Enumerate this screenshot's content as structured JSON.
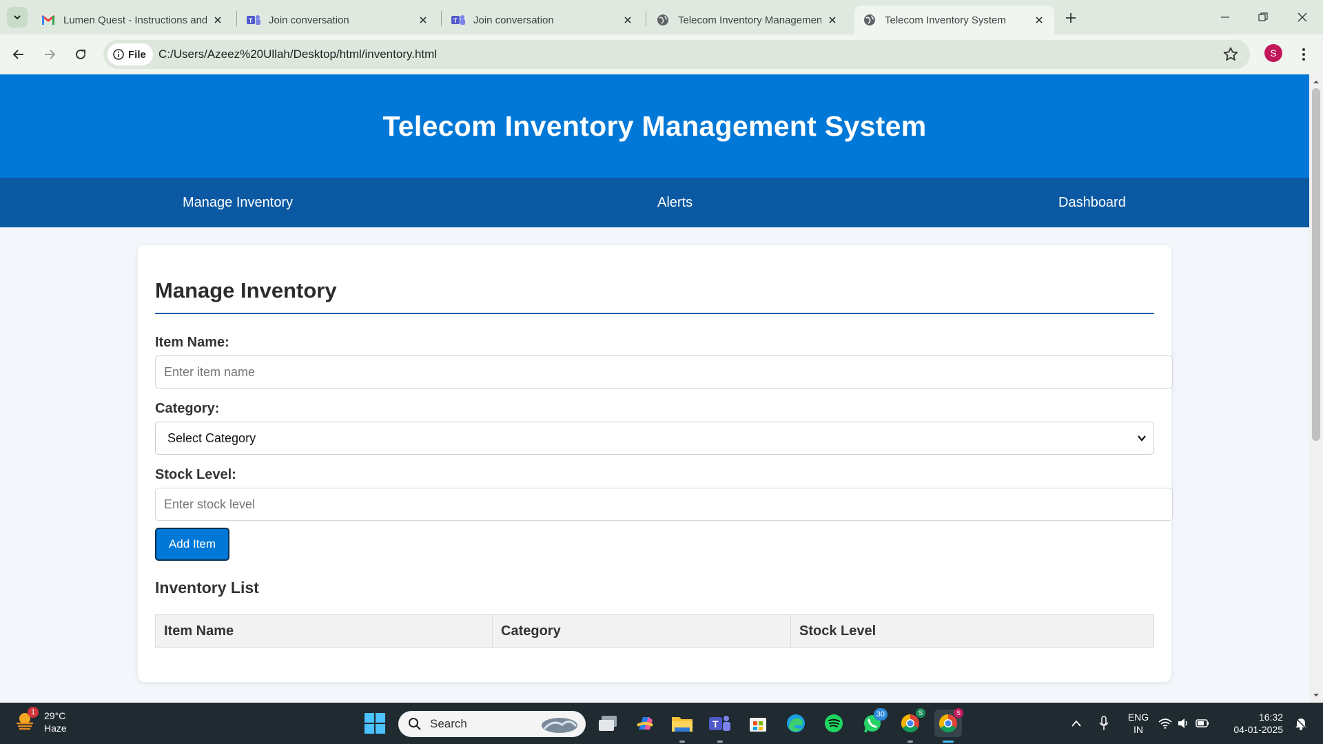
{
  "browser": {
    "tabs": [
      {
        "title": "Lumen Quest - Instructions and",
        "icon": "gmail-icon"
      },
      {
        "title": "Join conversation",
        "icon": "teams-icon"
      },
      {
        "title": "Join conversation",
        "icon": "teams-icon"
      },
      {
        "title": "Telecom Inventory Managemen",
        "icon": "globe-icon"
      },
      {
        "title": "Telecom Inventory System",
        "icon": "globe-icon",
        "active": true
      }
    ],
    "address": {
      "chip_label": "File",
      "url": "C:/Users/Azeez%20Ullah/Desktop/html/inventory.html"
    },
    "profile_initial": "S"
  },
  "page": {
    "header_title": "Telecom Inventory Management System",
    "nav": [
      "Manage Inventory",
      "Alerts",
      "Dashboard"
    ],
    "section_title": "Manage Inventory",
    "form": {
      "item_name_label": "Item Name:",
      "item_name_placeholder": "Enter item name",
      "category_label": "Category:",
      "category_selected": "Select Category",
      "stock_label": "Stock Level:",
      "stock_placeholder": "Enter stock level",
      "add_button": "Add Item"
    },
    "list_title": "Inventory List",
    "table_headers": [
      "Item Name",
      "Category",
      "Stock Level"
    ]
  },
  "taskbar": {
    "weather": {
      "temp": "29°C",
      "desc": "Haze",
      "badge": "1"
    },
    "search_label": "Search",
    "whatsapp_badge": "30",
    "chrome_profile_badge": "S",
    "lang_top": "ENG",
    "lang_bottom": "IN",
    "time": "16:32",
    "date": "04-01-2025"
  },
  "colors": {
    "header_blue": "#0078d7",
    "nav_blue": "#0b59a3",
    "tab_strip": "#dfe9df"
  }
}
